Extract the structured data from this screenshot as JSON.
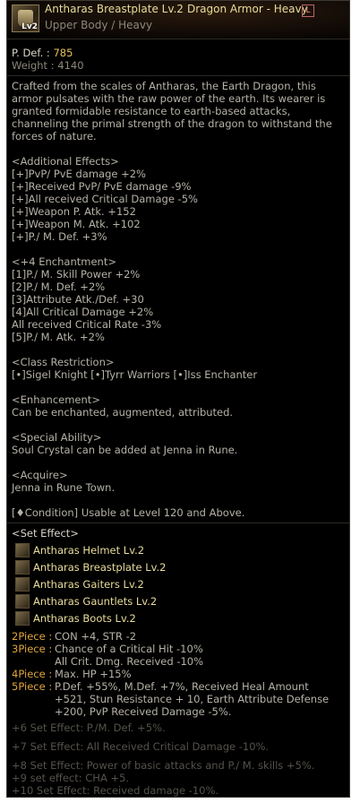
{
  "item": {
    "name": "Antharas Breastplate Lv.2",
    "grade": "Dragon Armor - Heavy",
    "slot": "Upper Body / Heavy",
    "icon": "breastplate-icon",
    "icon_level": "Lv2",
    "tag_icon": "L"
  },
  "stats": {
    "pdef_label": "P. Def. : ",
    "pdef_value": "785",
    "weight_label": "Weight : ",
    "weight_value": "4140"
  },
  "description": "Crafted from the scales of Antharas, the Earth Dragon, this armor pulsates with the raw power of the earth. Its wearer is granted formidable resistance to earth-based attacks, channeling the primal strength of the dragon to withstand the forces of nature.",
  "additional_effects": {
    "title": "<Additional Effects>",
    "lines": [
      "[+]PvP/ PvE damage +2%",
      "[+]Received PvP/ PvE damage -9%",
      "[+]All received Critical Damage -5%",
      "[+]Weapon P. Atk. +152",
      "[+]Weapon M. Atk. +102",
      "[+]P./ M. Def. +3%"
    ]
  },
  "enchantment": {
    "title": "<+4 Enchantment>",
    "lines": [
      "[1]P./ M. Skill Power +2%",
      "[2]P./ M. Def. +2%",
      "[3]Attribute Atk./Def. +30",
      "[4]All Critical Damage +2%",
      "All received Critical Rate -3%",
      "[5]P./ M. Atk. +2%"
    ]
  },
  "class_restriction": {
    "title": "<Class Restriction>",
    "text": "[•]Sigel Knight [•]Tyrr Warriors [•]Iss Enchanter"
  },
  "enhancement": {
    "title": "<Enhancement>",
    "text": "Can be enchanted, augmented, attributed."
  },
  "special_ability": {
    "title": "<Special Ability>",
    "text": "Soul Crystal can be added at Jenna in Rune."
  },
  "acquire": {
    "title": "<Acquire>",
    "text": "Jenna in Rune Town."
  },
  "condition": "[♦Condition] Usable at Level 120 and Above.",
  "set_effect": {
    "title": "<Set Effect>",
    "items": [
      {
        "name": "Antharas Helmet Lv.2",
        "icon": "helmet-icon"
      },
      {
        "name": "Antharas Breastplate Lv.2",
        "icon": "breastplate-icon"
      },
      {
        "name": "Antharas Gaiters Lv.2",
        "icon": "gaiters-icon"
      },
      {
        "name": "Antharas Gauntlets Lv.2",
        "icon": "gauntlets-icon"
      },
      {
        "name": "Antharas Boots Lv.2",
        "icon": "boots-icon"
      }
    ],
    "pieces": [
      {
        "key": "2Piece :",
        "lines": [
          "CON +4, STR -2"
        ]
      },
      {
        "key": "3Piece :",
        "lines": [
          "Chance of a Critical Hit -10%",
          "All Crit. Dmg. Received -10%"
        ]
      },
      {
        "key": "4Piece :",
        "lines": [
          "Max. HP +15%"
        ]
      },
      {
        "key": "5Piece :",
        "lines": [
          "P.Def. +55%, M.Def. +7%, Received Heal Amount +521, Stun Resistance + 10,  Earth Attribute Defense +200, PvP Received Damage -5%."
        ]
      }
    ],
    "enchant_effects": [
      "+6 Set Effect: P./M. Def. +5%.",
      "+7 Set Effect: All Received Critical Damage -10%.",
      "+8 Set Effect: Power of basic attacks and P./ M. skills +5%.",
      "+9 set effect: CHA +5.",
      "+10 Set Effect: Received damage -10%."
    ]
  }
}
